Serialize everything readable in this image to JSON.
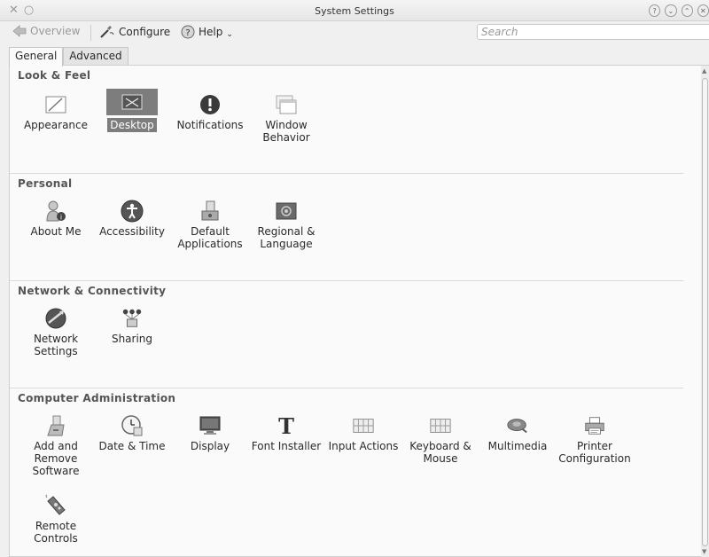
{
  "window": {
    "title": "System Settings"
  },
  "toolbar": {
    "overview_label": "Overview",
    "configure_label": "Configure",
    "help_label": "Help",
    "search_placeholder": "Search"
  },
  "tabs": [
    {
      "label": "General",
      "active": true
    },
    {
      "label": "Advanced",
      "active": false
    }
  ],
  "sections": [
    {
      "title": "Look & Feel",
      "items": [
        {
          "label": "Appearance",
          "icon": "appearance-icon"
        },
        {
          "label": "Desktop",
          "icon": "desktop-icon",
          "selected": true
        },
        {
          "label": "Notifications",
          "icon": "notifications-icon"
        },
        {
          "label": "Window Behavior",
          "icon": "window-behavior-icon"
        }
      ]
    },
    {
      "title": "Personal",
      "items": [
        {
          "label": "About Me",
          "icon": "about-me-icon"
        },
        {
          "label": "Accessibility",
          "icon": "accessibility-icon"
        },
        {
          "label": "Default Applications",
          "icon": "default-applications-icon"
        },
        {
          "label": "Regional & Language",
          "icon": "regional-language-icon"
        }
      ]
    },
    {
      "title": "Network & Connectivity",
      "items": [
        {
          "label": "Network Settings",
          "icon": "network-settings-icon"
        },
        {
          "label": "Sharing",
          "icon": "sharing-icon"
        }
      ]
    },
    {
      "title": "Computer Administration",
      "items": [
        {
          "label": "Add and Remove Software",
          "icon": "software-icon"
        },
        {
          "label": "Date & Time",
          "icon": "date-time-icon"
        },
        {
          "label": "Display",
          "icon": "display-icon"
        },
        {
          "label": "Font Installer",
          "icon": "font-installer-icon"
        },
        {
          "label": "Input Actions",
          "icon": "input-actions-icon"
        },
        {
          "label": "Keyboard & Mouse",
          "icon": "keyboard-mouse-icon"
        },
        {
          "label": "Multimedia",
          "icon": "multimedia-icon"
        },
        {
          "label": "Printer Configuration",
          "icon": "printer-icon"
        },
        {
          "label": "Remote Controls",
          "icon": "remote-controls-icon"
        }
      ]
    }
  ]
}
